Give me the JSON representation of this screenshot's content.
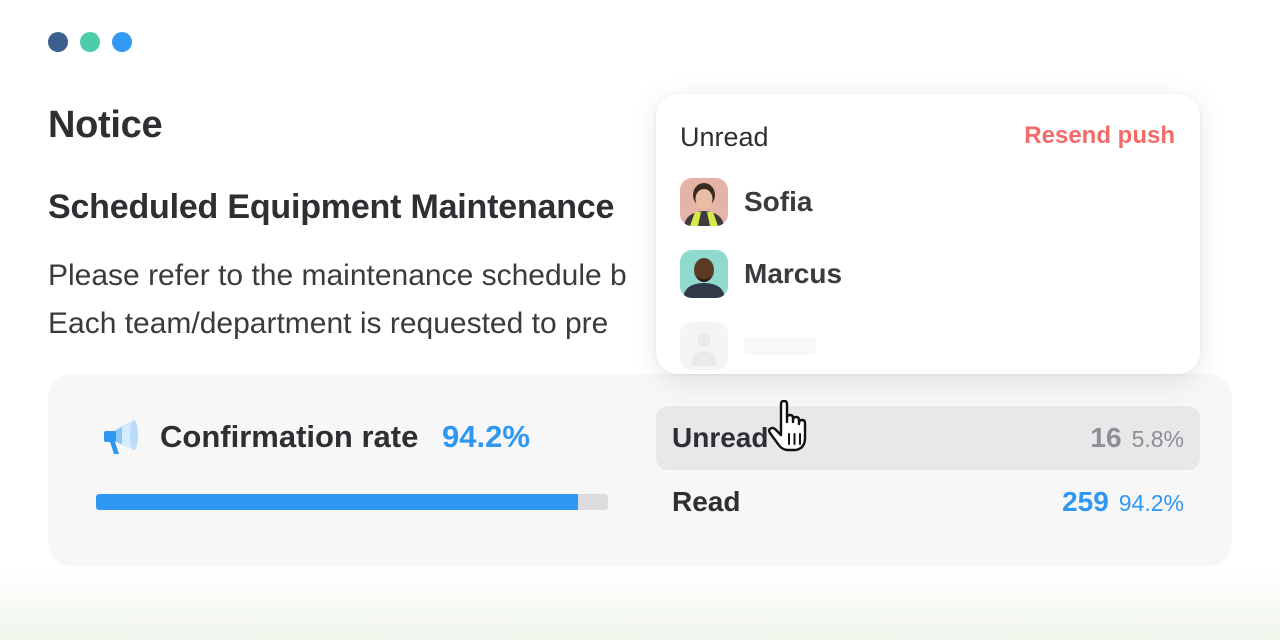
{
  "window": {
    "dots": [
      {
        "name": "dot-dark-blue",
        "color": "#3d5f8f"
      },
      {
        "name": "dot-teal",
        "color": "#4ecba9"
      },
      {
        "name": "dot-blue",
        "color": "#3399f3"
      }
    ]
  },
  "page": {
    "title": "Notice",
    "notice_heading": "Scheduled Equipment Maintenance",
    "body_lines": [
      "Please refer to the maintenance schedule b",
      "Each team/department is requested to pre"
    ]
  },
  "confirmation": {
    "icon": "megaphone-icon",
    "label": "Confirmation rate",
    "rate_text": "94.2%",
    "progress_fraction": 0.942
  },
  "stats": {
    "unread": {
      "label": "Unread",
      "count": "16",
      "percent": "5.8%"
    },
    "read": {
      "label": "Read",
      "count": "259",
      "percent": "94.2%"
    }
  },
  "popup": {
    "title": "Unread",
    "action_label": "Resend push",
    "users": [
      {
        "name": "Sofia"
      },
      {
        "name": "Marcus"
      }
    ]
  },
  "colors": {
    "accent_blue": "#2e97f2",
    "action_red": "#f26b68",
    "muted_gray": "#8e8e93"
  }
}
